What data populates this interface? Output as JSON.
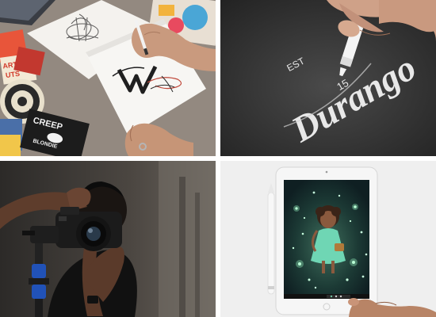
{
  "layout": "2x2-photo-grid",
  "photos": {
    "top_left": {
      "stickers": {
        "party_line1": "ARTY",
        "party_line2": "UTS",
        "creep_line1": "CREEP",
        "creep_line2": "BLONDIE"
      }
    },
    "top_right": {
      "lettering_est": "EST",
      "lettering_main": "Durango",
      "lettering_year": "15"
    },
    "bottom_left": {},
    "bottom_right": {}
  },
  "colors": {
    "tile_gap": "#ffffff",
    "chalkboard": "#2f2f2f",
    "camera_body": "#1b1b1b",
    "ipad_frame": "#f4f4f4",
    "glow": "#a8ffd0"
  }
}
